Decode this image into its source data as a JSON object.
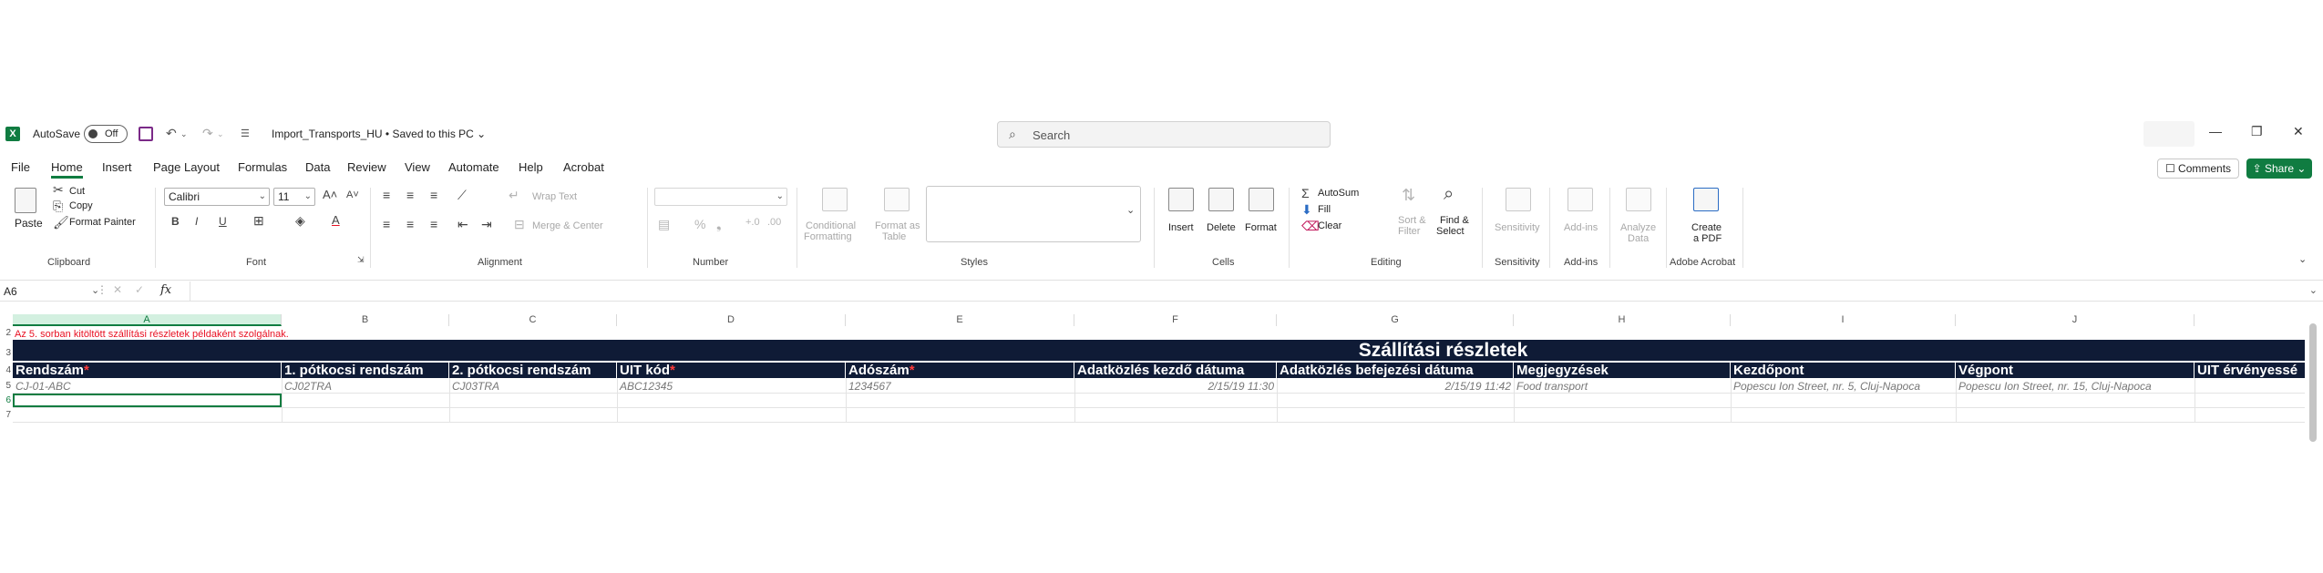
{
  "titlebar": {
    "autosave_label": "AutoSave",
    "autosave_state": "Off",
    "doc_title": "Import_Transports_HU • Saved to this PC ⌄",
    "search_placeholder": "Search"
  },
  "menu": {
    "tabs": [
      "File",
      "Home",
      "Insert",
      "Page Layout",
      "Formulas",
      "Data",
      "Review",
      "View",
      "Automate",
      "Help",
      "Acrobat"
    ],
    "active_tab": "Home",
    "comments": "Comments",
    "share": "Share"
  },
  "ribbon": {
    "clipboard": {
      "paste": "Paste",
      "cut": "Cut",
      "copy": "Copy",
      "format_painter": "Format Painter",
      "label": "Clipboard"
    },
    "font": {
      "name": "Calibri",
      "size": "11",
      "label": "Font"
    },
    "alignment": {
      "wrap_text": "Wrap Text",
      "merge_center": "Merge & Center",
      "label": "Alignment"
    },
    "number": {
      "label": "Number"
    },
    "styles": {
      "conditional": "Conditional",
      "conditional2": "Formatting",
      "format_as": "Format as",
      "table": "Table",
      "label": "Styles"
    },
    "cells": {
      "insert": "Insert",
      "delete": "Delete",
      "format": "Format",
      "label": "Cells"
    },
    "editing": {
      "autosum": "AutoSum",
      "fill": "Fill",
      "clear": "Clear",
      "sort1": "Sort &",
      "sort2": "Filter",
      "find1": "Find &",
      "find2": "Select",
      "label": "Editing"
    },
    "sensitivity": {
      "btn": "Sensitivity",
      "label": "Sensitivity"
    },
    "addins": {
      "btn": "Add-ins",
      "label": "Add-ins"
    },
    "analyze": {
      "btn1": "Analyze",
      "btn2": "Data"
    },
    "acrobat": {
      "btn1": "Create",
      "btn2": "a PDF",
      "label": "Adobe Acrobat"
    }
  },
  "formula_bar": {
    "name_box": "A6",
    "fx": "fx"
  },
  "sheet": {
    "columns": [
      "A",
      "B",
      "C",
      "D",
      "E",
      "F",
      "G",
      "H",
      "I",
      "J"
    ],
    "selected_column": "A",
    "rows": [
      "2",
      "3",
      "4",
      "5",
      "6",
      "7"
    ],
    "note": "Az 5. sorban kitöltött szállítási részletek példaként szolgálnak.",
    "title": "Szállítási részletek",
    "headers": [
      {
        "text": "Rendszám",
        "req": "*"
      },
      {
        "text": "1. pótkocsi rendszám",
        "req": ""
      },
      {
        "text": "2. pótkocsi rendszám",
        "req": ""
      },
      {
        "text": "UIT kód",
        "req": "*"
      },
      {
        "text": "Adószám",
        "req": "*"
      },
      {
        "text": "Adatközlés kezdő dátuma",
        "req": ""
      },
      {
        "text": "Adatközlés befejezési dátuma",
        "req": ""
      },
      {
        "text": "Megjegyzések",
        "req": ""
      },
      {
        "text": "Kezdőpont",
        "req": ""
      },
      {
        "text": "Végpont",
        "req": ""
      },
      {
        "text": "UIT érvényessé",
        "req": ""
      }
    ],
    "example_row": [
      "CJ-01-ABC",
      "CJ02TRA",
      "CJ03TRA",
      "ABC12345",
      "1234567",
      "2/15/19 11:30",
      "2/15/19 11:42",
      "Food transport",
      "Popescu Ion Street, nr. 5, Cluj-Napoca",
      "Popescu Ion Street, nr. 15, Cluj-Napoca"
    ]
  }
}
